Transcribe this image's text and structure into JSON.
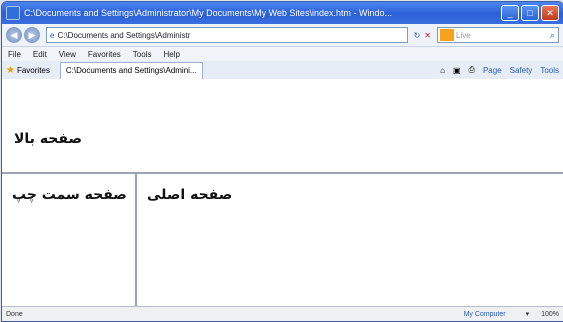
{
  "window": {
    "title": "C:\\Documents and Settings\\Administrator\\My Documents\\My Web Sites\\index.htm - Windo..."
  },
  "addressbar": {
    "url": "C:\\Documents and Settings\\Administr",
    "search_placeholder": "Live"
  },
  "menu": [
    "File",
    "Edit",
    "View",
    "Favorites",
    "Tools",
    "Help"
  ],
  "favbar": {
    "favorites_label": "Favorites",
    "tab_label": "C:\\Documents and Settings\\Admini...",
    "toolbar": [
      "Page",
      "Safety",
      "Tools"
    ]
  },
  "frames": {
    "top_text": "صفحه بالا",
    "left_text": "صفحه سمت چپ",
    "main_text": "صفحه اصلی"
  },
  "statusbar": {
    "status": "Done",
    "zone": "My Computer",
    "zoom": "100%"
  }
}
